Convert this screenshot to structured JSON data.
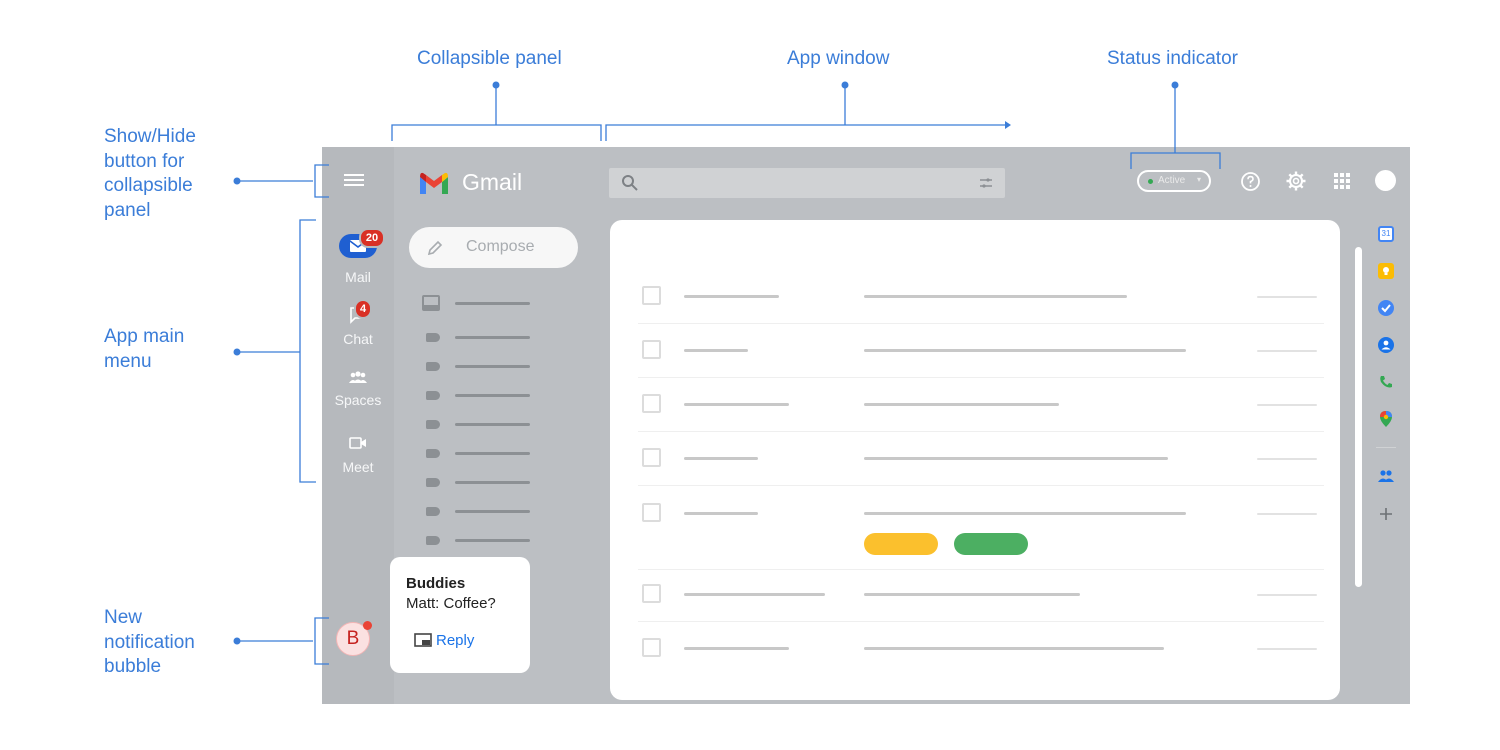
{
  "callouts": {
    "collapsible_panel": "Collapsible panel",
    "app_window": "App window",
    "status_indicator": "Status indicator",
    "show_hide": [
      "Show/Hide",
      "button for",
      "collapsible",
      "panel"
    ],
    "app_main_menu": [
      "App main",
      "menu"
    ],
    "new_notification": [
      "New",
      "notification",
      "bubble"
    ]
  },
  "gmail": {
    "logo_text": "Gmail",
    "compose_label": "Compose",
    "status_label": "Active",
    "rail": {
      "mail": {
        "label": "Mail",
        "badge": "20"
      },
      "chat": {
        "label": "Chat",
        "badge": "4"
      },
      "spaces": {
        "label": "Spaces"
      },
      "meet": {
        "label": "Meet"
      }
    },
    "notification": {
      "avatar_letter": "B",
      "title": "Buddies",
      "message": "Matt: Coffee?",
      "reply_label": "Reply"
    },
    "chips": {
      "yellow": "#fbc02d",
      "green": "#4caf62"
    }
  },
  "colors": {
    "callout": "#3b7dd8",
    "screen_bg": "#bcbfc3",
    "mail_accent": "#1f5fd1",
    "badge_red": "#d93025"
  }
}
